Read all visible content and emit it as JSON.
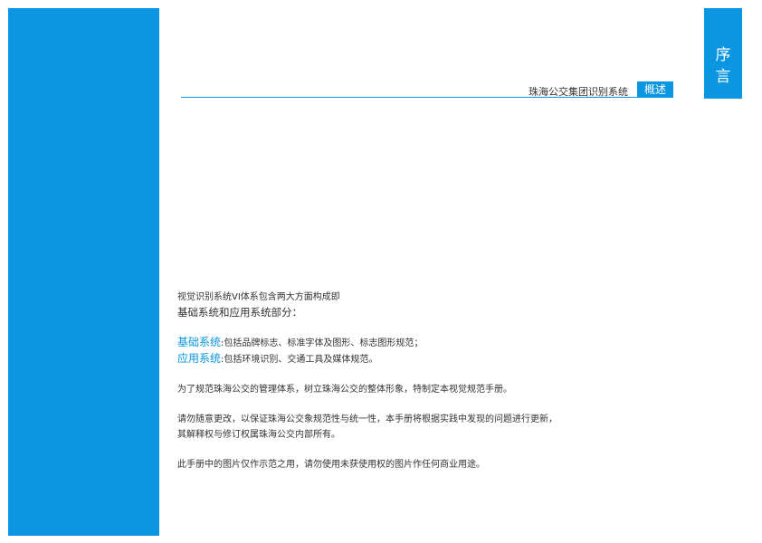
{
  "header": {
    "title": "珠海公交集团识别系统",
    "badge": "概述"
  },
  "section_tab": {
    "chars": [
      "序",
      "言"
    ]
  },
  "content": {
    "intro_line1": "视觉识别系统VI体系包含两大方面构成即",
    "intro_line2": "基础系统和应用系统部分：",
    "basic_label": "基础系统",
    "basic_desc": ":包括品牌标志、标准字体及图形、标志图形规范；",
    "app_label": "应用系统",
    "app_desc": ":包括环境识别、交通工具及媒体规范。",
    "purpose": "为了规范珠海公交的管理体系，树立珠海公交的整体形象，特制定本视觉规范手册。",
    "notice_line1": "请勿随意更改，以保证珠海公交象规范性与统一性，本手册将根据实践中发现的问题进行更新，",
    "notice_line2": "其解释权与修订权属珠海公交内部所有。",
    "disclaimer": "此手册中的图片仅作示范之用，请勿使用未获使用权的图片作任何商业用途。"
  },
  "colors": {
    "accent": "#0a96e0",
    "text": "#333333",
    "background": "#ffffff"
  }
}
